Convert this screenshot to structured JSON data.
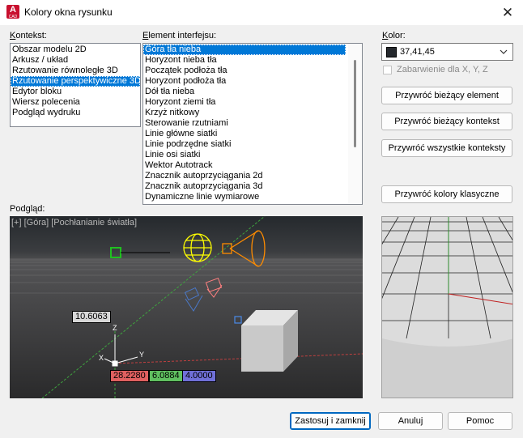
{
  "window": {
    "title": "Kolory okna rysunku",
    "close_glyph": "✕",
    "app_icon_letter": "A",
    "app_icon_sub": "CAD"
  },
  "context": {
    "label": "Kontekst:",
    "items": [
      {
        "label": "Obszar modelu 2D",
        "selected": false
      },
      {
        "label": "Arkusz / układ",
        "selected": false
      },
      {
        "label": "Rzutowanie równoległe 3D",
        "selected": false
      },
      {
        "label": "Rzutowanie perspektywiczne 3D",
        "selected": true
      },
      {
        "label": "Edytor bloku",
        "selected": false
      },
      {
        "label": "Wiersz polecenia",
        "selected": false
      },
      {
        "label": "Podgląd wydruku",
        "selected": false
      }
    ]
  },
  "element": {
    "label": "Element interfejsu:",
    "items": [
      {
        "label": "Góra tła nieba",
        "selected": true
      },
      {
        "label": "Horyzont nieba tła",
        "selected": false
      },
      {
        "label": "Początek podłoża tła",
        "selected": false
      },
      {
        "label": "Horyzont podłoża tła",
        "selected": false
      },
      {
        "label": "Dół tła nieba",
        "selected": false
      },
      {
        "label": "Horyzont ziemi tła",
        "selected": false
      },
      {
        "label": "Krzyż nitkowy",
        "selected": false
      },
      {
        "label": "Sterowanie rzutniami",
        "selected": false
      },
      {
        "label": "Linie główne siatki",
        "selected": false
      },
      {
        "label": "Linie podrzędne siatki",
        "selected": false
      },
      {
        "label": "Linie osi siatki",
        "selected": false
      },
      {
        "label": "Wektor Autotrack",
        "selected": false
      },
      {
        "label": "Znacznik autoprzyciągania 2d",
        "selected": false
      },
      {
        "label": "Znacznik autoprzyciągania 3d",
        "selected": false
      },
      {
        "label": "Dynamiczne linie wymiarowe",
        "selected": false
      }
    ]
  },
  "color": {
    "label": "Kolor:",
    "value": "37,41,45",
    "swatch": "#25292d",
    "tint_label": "Zabarwienie dla X, Y, Z",
    "tint_checked": false,
    "tint_enabled": false
  },
  "buttons": {
    "restore_element": "Przywróć bieżący element",
    "restore_context": "Przywróć bieżący kontekst",
    "restore_all": "Przywróć wszystkie konteksty",
    "restore_classic": "Przywróć kolory klasyczne",
    "apply_close": "Zastosuj i zamknij",
    "cancel": "Anuluj",
    "help": "Pomoc"
  },
  "preview": {
    "label": "Podgląd:",
    "viewport_label": "[+] [Góra] [Pochłanianie światła]",
    "dim_length": "10.6063",
    "coord_x": "28.2280",
    "coord_y": "6.0884",
    "coord_z": "4.0000",
    "axis_x": "X",
    "axis_y": "Y",
    "axis_z": "Z",
    "sky_top_color": "#25292d"
  }
}
